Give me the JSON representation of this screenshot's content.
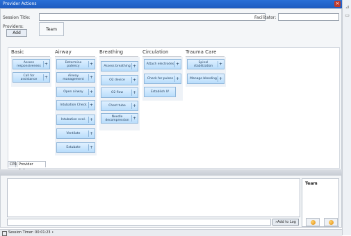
{
  "window": {
    "title": "Provider Actions",
    "close_glyph": "×"
  },
  "session": {
    "title_label": "Session Title:",
    "title_value": "",
    "facilitator_label": "Facilitator:",
    "facilitator_value": ""
  },
  "providers": {
    "label": "Providers:",
    "add_label": "Add",
    "team_label": "Team"
  },
  "columns": [
    {
      "name": "Basic",
      "actions": [
        "Assess responsiveness",
        "Call for assistance"
      ]
    },
    {
      "name": "Airway",
      "actions": [
        "Determine patency",
        "Airway management",
        "Open airway",
        "Intubation Check",
        "Intubation eval.",
        "Ventilate",
        "Extubate"
      ]
    },
    {
      "name": "Breathing",
      "actions": [
        "Assess breathing",
        "O2 device",
        "O2 flow",
        "Chest tube",
        "Needle decompression"
      ]
    },
    {
      "name": "Circulation",
      "actions": [
        "Attach electrodes",
        "Check for pulses",
        "Establish IV"
      ]
    },
    {
      "name": "Trauma Care",
      "actions": [
        "Spinal stabilization",
        "Manage bleeding"
      ]
    }
  ],
  "plus_glyph": "+",
  "tabs": [
    "CPR",
    "Provider Actions"
  ],
  "log": {
    "team_header": "Team",
    "add_to_log_label": "Add to Log"
  },
  "status": {
    "session_timer": "Session Timer: 00:01:23 •"
  }
}
